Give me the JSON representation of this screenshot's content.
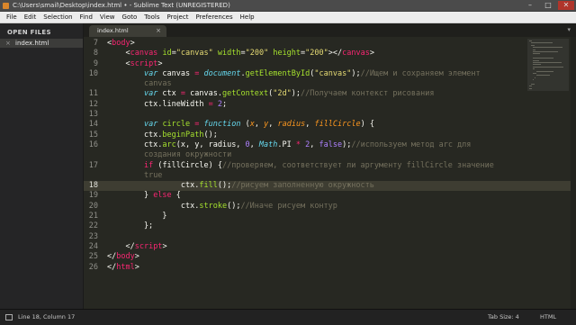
{
  "window": {
    "title": "C:\\Users\\smail\\Desktop\\index.html • - Sublime Text (UNREGISTERED)",
    "controls": {
      "minimize": "–",
      "maximize": "□",
      "close": "✕"
    }
  },
  "menu": [
    "File",
    "Edit",
    "Selection",
    "Find",
    "View",
    "Goto",
    "Tools",
    "Project",
    "Preferences",
    "Help"
  ],
  "sidebar": {
    "heading": "OPEN FILES",
    "file": "index.html",
    "close_glyph": "×"
  },
  "tabs": [
    {
      "label": "index.html",
      "close": "×"
    }
  ],
  "tab_arrow": "▾",
  "editor": {
    "lines": [
      {
        "n": "7",
        "html": "<span class='ig'></span>&lt;<span class='t'>body</span>&gt;"
      },
      {
        "n": "8",
        "html": "    &lt;<span class='t'>canvas</span> <span class='a'>id</span>=<span class='s'>\"canvas\"</span> <span class='a'>width</span>=<span class='s'>\"200\"</span> <span class='a'>height</span>=<span class='s'>\"200\"</span>&gt;&lt;/<span class='t'>canvas</span>&gt;"
      },
      {
        "n": "9",
        "html": "    &lt;<span class='t'>script</span>&gt;"
      },
      {
        "n": "10",
        "html": "        <span class='k'>var</span> canvas <span class='o'>=</span> <span class='i'>document</span>.<span class='a'>getElementById</span>(<span class='s'>\"canvas\"</span>);<span class='c'>//Ищем и сохраняем элемент</span>"
      },
      {
        "n": "",
        "html": "        <span class='c'>canvas</span>"
      },
      {
        "n": "11",
        "html": "        <span class='k'>var</span> ctx <span class='o'>=</span> canvas.<span class='a'>getContext</span>(<span class='s'>\"2d\"</span>);<span class='c'>//Получаем контекст рисования</span>"
      },
      {
        "n": "12",
        "html": "        ctx.lineWidth <span class='o'>=</span> <span class='n'>2</span>;"
      },
      {
        "n": "13",
        "html": ""
      },
      {
        "n": "14",
        "html": "        <span class='k'>var</span> <span class='a'>circle</span> <span class='o'>=</span> <span class='k'>function</span> (<span class='p'>x</span>, <span class='p'>y</span>, <span class='p'>radius</span>, <span class='p'>fillCircle</span>) {"
      },
      {
        "n": "15",
        "html": "        ctx.<span class='a'>beginPath</span>();"
      },
      {
        "n": "16",
        "html": "        ctx.<span class='a'>arc</span>(x, y, radius, <span class='n'>0</span>, <span class='i'>Math</span>.PI <span class='o'>*</span> <span class='n'>2</span>, <span class='n'>false</span>);<span class='c'>//используем метод arc для</span>"
      },
      {
        "n": "",
        "html": "        <span class='c'>создания окружности</span>"
      },
      {
        "n": "17",
        "html": "        <span class='o'>if</span> (fillCircle) {<span class='c'>//проверяем, соответствует ли аргументу fillCircle значение</span>"
      },
      {
        "n": "",
        "html": "        <span class='c'>true</span>"
      },
      {
        "n": "18",
        "html": "                ctx.<span class='a'>fill</span>();<span class='c'>//рисуем заполненную окружность</span>",
        "current": true
      },
      {
        "n": "19",
        "html": "        } <span class='o'>else</span> {"
      },
      {
        "n": "20",
        "html": "                ctx.<span class='a'>stroke</span>();<span class='c'>//Иначе рисуем контур</span>"
      },
      {
        "n": "21",
        "html": "            }"
      },
      {
        "n": "22",
        "html": "        };"
      },
      {
        "n": "23",
        "html": ""
      },
      {
        "n": "24",
        "html": "    &lt;/<span class='t'>script</span>&gt;"
      },
      {
        "n": "25",
        "html": "&lt;/<span class='t'>body</span>&gt;"
      },
      {
        "n": "26",
        "html": "&lt;/<span class='t'>html</span>&gt;"
      }
    ]
  },
  "status": {
    "position": "Line 18, Column 17",
    "tab_size": "Tab Size: 4",
    "syntax": "HTML"
  }
}
